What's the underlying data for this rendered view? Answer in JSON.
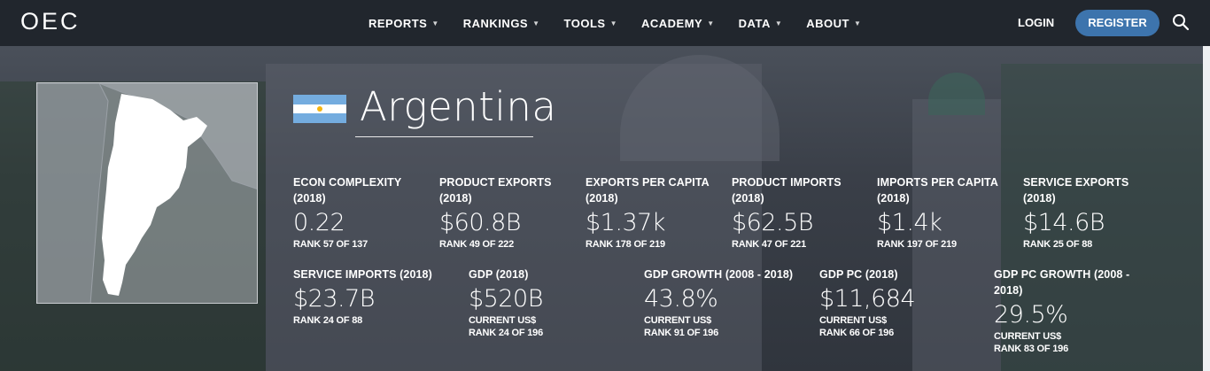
{
  "logo": "OEC",
  "nav": [
    {
      "label": "REPORTS"
    },
    {
      "label": "RANKINGS"
    },
    {
      "label": "TOOLS"
    },
    {
      "label": "ACADEMY"
    },
    {
      "label": "DATA"
    },
    {
      "label": "ABOUT"
    }
  ],
  "auth": {
    "login": "LOGIN",
    "register": "REGISTER"
  },
  "colors": {
    "nav_bg": "#21262d",
    "register_bg": "#3d74ad",
    "flag_blue": "#74acdf",
    "flag_sun": "#f6b40e"
  },
  "icons": {
    "search": "search-icon",
    "caret": "chevron-down-icon"
  },
  "country": {
    "name": "Argentina"
  },
  "stats_row1": [
    {
      "label": "ECON COMPLEXITY (2018)",
      "value": "0.22",
      "sub": "RANK 57 OF 137"
    },
    {
      "label": "PRODUCT EXPORTS (2018)",
      "value": "$60.8B",
      "sub": "RANK 49 OF 222"
    },
    {
      "label": "EXPORTS PER CAPITA (2018)",
      "value": "$1.37k",
      "sub": "RANK 178 OF 219"
    },
    {
      "label": "PRODUCT IMPORTS (2018)",
      "value": "$62.5B",
      "sub": "RANK 47 OF 221"
    },
    {
      "label": "IMPORTS PER CAPITA (2018)",
      "value": "$1.4k",
      "sub": "RANK 197 OF 219"
    },
    {
      "label": "SERVICE EXPORTS (2018)",
      "value": "$14.6B",
      "sub": "RANK 25 OF 88"
    }
  ],
  "stats_row2": [
    {
      "label": "SERVICE IMPORTS (2018)",
      "value": "$23.7B",
      "sub": "RANK 24 OF 88",
      "sub2": ""
    },
    {
      "label": "GDP (2018)",
      "value": "$520B",
      "sub": "CURRENT US$",
      "sub2": "RANK 24 OF 196"
    },
    {
      "label": "GDP GROWTH (2008 - 2018)",
      "value": "43.8%",
      "sub": "CURRENT US$",
      "sub2": "RANK 91 OF 196"
    },
    {
      "label": "GDP PC (2018)",
      "value": "$11,684",
      "sub": "CURRENT US$",
      "sub2": "RANK 66 OF 196"
    },
    {
      "label": "GDP PC GROWTH (2008 - 2018)",
      "value": "29.5%",
      "sub": "CURRENT US$",
      "sub2": "RANK 83 OF 196"
    }
  ]
}
